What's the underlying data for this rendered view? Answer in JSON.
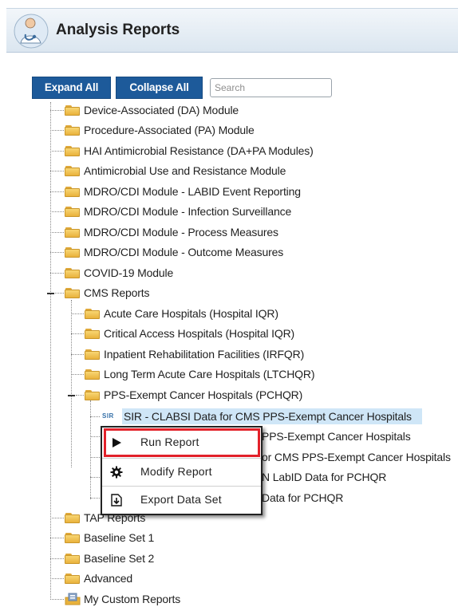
{
  "header": {
    "title": "Analysis Reports",
    "icon": "doctor-icon"
  },
  "toolbar": {
    "expand_label": "Expand All",
    "collapse_label": "Collapse All",
    "search_placeholder": "Search",
    "button_color": "#1d5a9a"
  },
  "tree": {
    "top_items": [
      "Device-Associated (DA) Module",
      "Procedure-Associated (PA) Module",
      "HAI Antimicrobial Resistance (DA+PA Modules)",
      "Antimicrobial Use and Resistance Module",
      "MDRO/CDI Module - LABID Event Reporting",
      "MDRO/CDI Module - Infection Surveillance",
      "MDRO/CDI Module - Process Measures",
      "MDRO/CDI Module - Outcome Measures",
      "COVID-19 Module"
    ],
    "cms": {
      "label": "CMS Reports",
      "children": [
        "Acute Care Hospitals (Hospital IQR)",
        "Critical Access Hospitals (Hospital IQR)",
        "Inpatient Rehabilitation Facilities (IRFQR)",
        "Long Term Acute Care Hospitals (LTCHQR)"
      ],
      "pps": {
        "label": "PPS-Exempt Cancer Hospitals (PCHQR)",
        "sir_badge": "SIR",
        "reports": [
          "SIR - CLABSI Data for CMS PPS-Exempt Cancer Hospitals",
          "PPS-Exempt Cancer Hospitals",
          "or CMS PPS-Exempt Cancer Hospitals",
          "N LabID Data for PCHQR",
          "Data for PCHQR"
        ]
      }
    },
    "bottom_items": [
      "TAP Reports",
      "Baseline Set 1",
      "Baseline Set 2",
      "Advanced",
      "My Custom Reports"
    ]
  },
  "context_menu": {
    "items": [
      {
        "label": "Run Report",
        "icon": "play-icon"
      },
      {
        "label": "Modify Report",
        "icon": "gear-icon"
      },
      {
        "label": "Export Data Set",
        "icon": "export-icon"
      }
    ],
    "highlight_color": "#e2212a"
  }
}
